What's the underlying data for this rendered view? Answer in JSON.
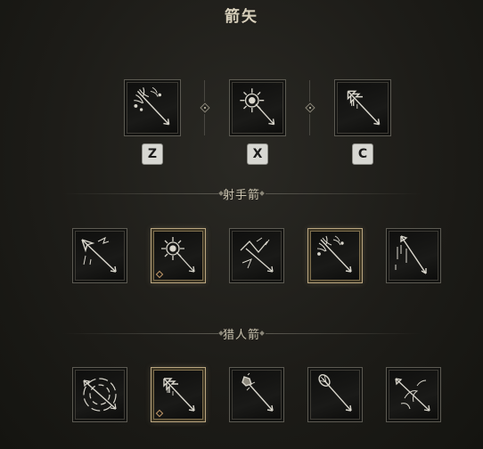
{
  "title": "箭矢",
  "equipped": {
    "slots": [
      {
        "key": "Z",
        "icon": "feathered-cluster-arrow-icon"
      },
      {
        "key": "X",
        "icon": "sunburst-arrow-icon"
      },
      {
        "key": "C",
        "icon": "serrated-arrow-icon"
      }
    ]
  },
  "archer_section": {
    "label": "射手箭",
    "items": [
      {
        "icon": "split-arrow-icon",
        "selected": false
      },
      {
        "icon": "sunburst-arrow-icon",
        "selected": true
      },
      {
        "icon": "ricochet-arrow-icon",
        "selected": false
      },
      {
        "icon": "feathered-cluster-arrow-icon",
        "selected": true
      },
      {
        "icon": "dripping-arrow-icon",
        "selected": false
      }
    ]
  },
  "hunter_section": {
    "label": "猎人箭",
    "items": [
      {
        "icon": "vortex-arrow-icon",
        "selected": false
      },
      {
        "icon": "serrated-arrow-icon",
        "selected": true
      },
      {
        "icon": "crystal-arrow-icon",
        "selected": false
      },
      {
        "icon": "thorned-arrow-icon",
        "selected": false
      },
      {
        "icon": "wisp-arrow-icon",
        "selected": false
      }
    ]
  },
  "colors": {
    "background": "#1d1c18",
    "slot_border": "#5c5a52",
    "selected_border": "#b9a57f",
    "marker": "#c59b6b",
    "key_bg": "#d7d7d2"
  }
}
